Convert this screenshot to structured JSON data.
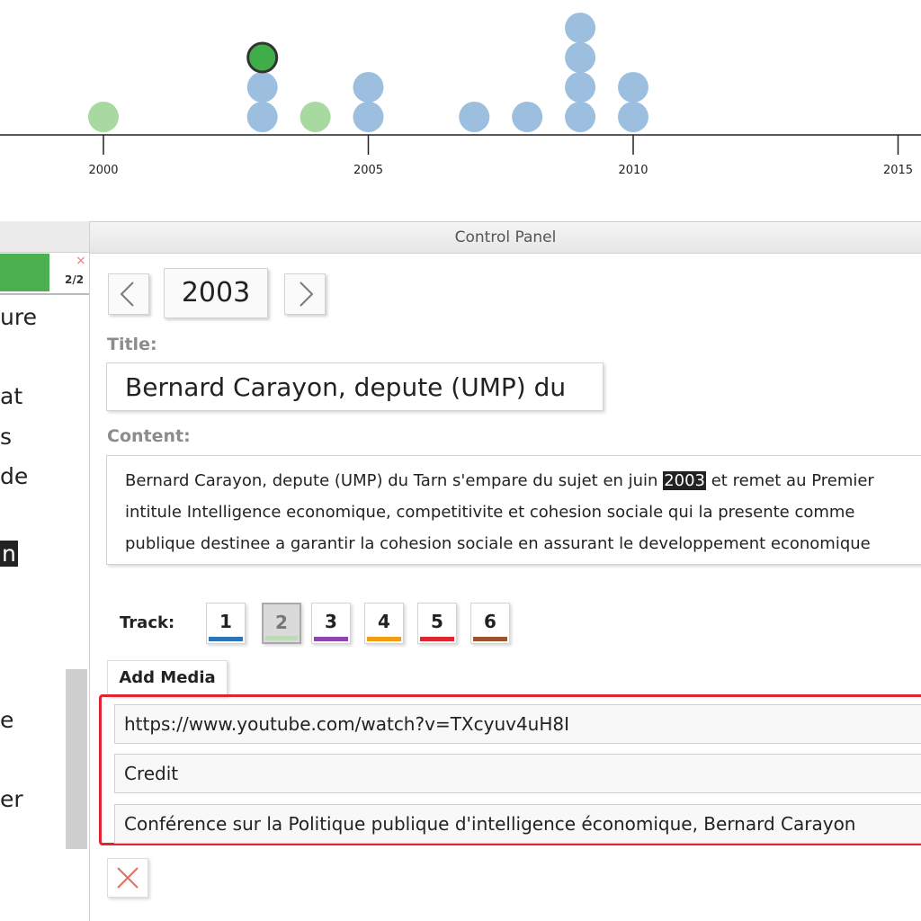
{
  "timeline": {
    "ticks": [
      {
        "year": 2000,
        "label": "2000"
      },
      {
        "year": 2005,
        "label": "2005"
      },
      {
        "year": 2010,
        "label": "2010"
      },
      {
        "year": 2015,
        "label": "2015"
      }
    ],
    "events": [
      {
        "year": 2000,
        "track": 2
      },
      {
        "year": 2003,
        "track": 1
      },
      {
        "year": 2003,
        "track": 1
      },
      {
        "year": 2003,
        "track": 2,
        "selected": true
      },
      {
        "year": 2004,
        "track": 2
      },
      {
        "year": 2005,
        "track": 1
      },
      {
        "year": 2005,
        "track": 1
      },
      {
        "year": 2007,
        "track": 1
      },
      {
        "year": 2008,
        "track": 1
      },
      {
        "year": 2009,
        "track": 1
      },
      {
        "year": 2009,
        "track": 1
      },
      {
        "year": 2009,
        "track": 1
      },
      {
        "year": 2009,
        "track": 1
      },
      {
        "year": 2010,
        "track": 1
      },
      {
        "year": 2010,
        "track": 1
      }
    ],
    "colors": {
      "track1": "#9dbfdf",
      "track2": "#a8d9a0",
      "selected_fill": "#3fae49",
      "selected_stroke": "#333333",
      "axis": "#222222"
    }
  },
  "left_panel": {
    "close_glyph": "×",
    "count": "2/2",
    "fragments": [
      {
        "text": "ure",
        "highlight": false
      },
      {
        "text": "at",
        "highlight": false
      },
      {
        "text": "s",
        "highlight": false
      },
      {
        "text": "de",
        "highlight": false
      },
      {
        "text": "n",
        "highlight": true
      },
      {
        "text": "e",
        "highlight": false
      },
      {
        "text": "er",
        "highlight": false
      }
    ]
  },
  "control_panel": {
    "header": "Control Panel",
    "year": "2003",
    "title_label": "Title:",
    "title_value": "Bernard Carayon, depute (UMP) du",
    "content_label": "Content:",
    "content_lines": [
      {
        "before": "Bernard Carayon, depute (UMP) du Tarn s'empare du sujet en juin ",
        "highlight": "2003",
        "after": " et remet au Premier"
      },
      {
        "before": "intitule Intelligence economique, competitivite et cohesion sociale qui la presente comme",
        "highlight": "",
        "after": ""
      },
      {
        "before": "publique destinee a garantir la cohesion sociale en assurant le developpement economique",
        "highlight": "",
        "after": ""
      }
    ],
    "track_label": "Track:",
    "tracks": [
      {
        "label": "1",
        "color": "#2f75b5",
        "active": false
      },
      {
        "label": "2",
        "color": "#b7dfb0",
        "active": true
      },
      {
        "label": "3",
        "color": "#8e44ad",
        "active": false
      },
      {
        "label": "4",
        "color": "#f39c12",
        "active": false
      },
      {
        "label": "5",
        "color": "#e02530",
        "active": false
      },
      {
        "label": "6",
        "color": "#a0522d",
        "active": false
      }
    ],
    "add_media_label": "Add Media",
    "media": {
      "url": "https://www.youtube.com/watch?v=TXcyuv4uH8I",
      "credit": "Credit",
      "caption": "Conférence sur la Politique publique d'intelligence économique, Bernard Carayon"
    },
    "highlight_color": "#e02530"
  }
}
